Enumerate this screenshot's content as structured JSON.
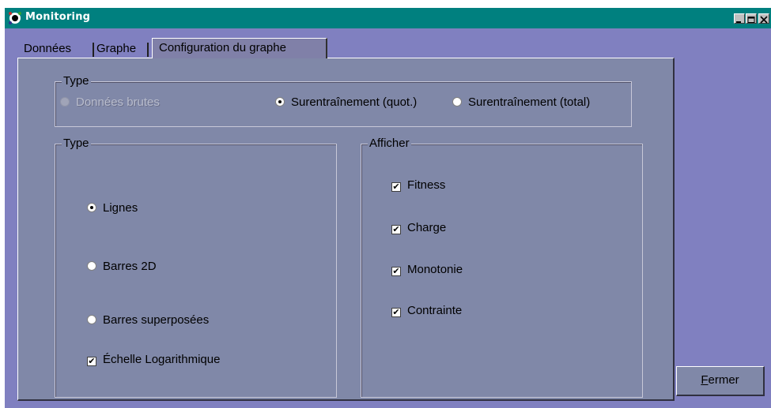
{
  "window": {
    "title": "Monitoring",
    "colors": {
      "titlebar": "#00807f",
      "background": "#8080c0",
      "panel": "#8088a8"
    }
  },
  "tabs": [
    {
      "label": "Données",
      "selected": false
    },
    {
      "label": "Graphe",
      "selected": false
    },
    {
      "label": "Configuration du graphe",
      "selected": true
    }
  ],
  "data_type_group": {
    "label": "Type",
    "options": [
      {
        "label": "Données brutes",
        "selected": false,
        "enabled": false
      },
      {
        "label": "Surentraînement (quot.)",
        "selected": true,
        "enabled": true
      },
      {
        "label": "Surentraînement (total)",
        "selected": false,
        "enabled": true
      }
    ]
  },
  "chart_type_group": {
    "label": "Type",
    "options": [
      {
        "label": "Lignes",
        "selected": true
      },
      {
        "label": "Barres 2D",
        "selected": false
      },
      {
        "label": "Barres superposées",
        "selected": false
      }
    ],
    "log_scale": {
      "label": "Échelle Logarithmique",
      "checked": true
    }
  },
  "display_group": {
    "label": "Afficher",
    "items": [
      {
        "label": "Fitness",
        "checked": true
      },
      {
        "label": "Charge",
        "checked": true
      },
      {
        "label": "Monotonie",
        "checked": true
      },
      {
        "label": "Contrainte",
        "checked": true
      }
    ]
  },
  "close_button": {
    "label_first": "F",
    "label_rest": "ermer"
  },
  "icons": {
    "app": "app-icon",
    "minimize": "minimize-icon",
    "maximize": "maximize-icon",
    "close": "close-icon",
    "check_mark": "✔"
  }
}
